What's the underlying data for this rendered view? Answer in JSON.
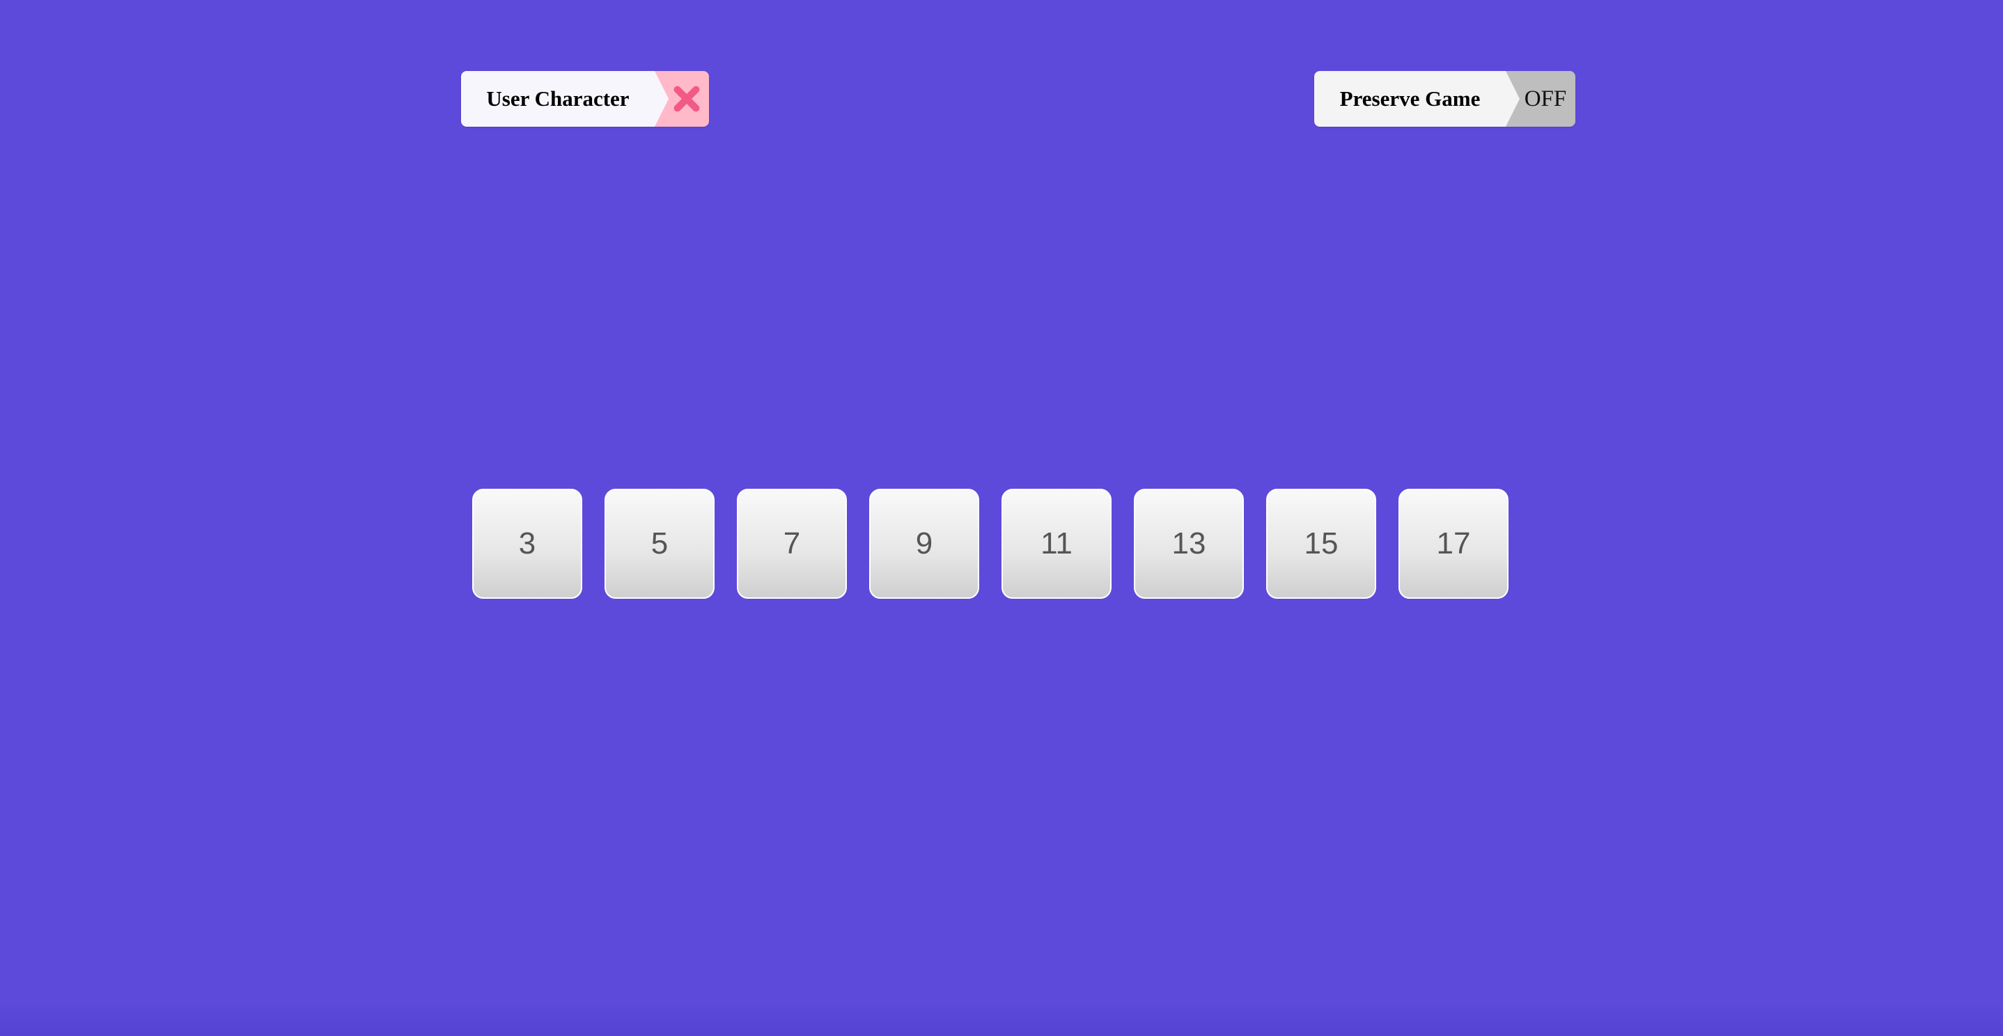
{
  "colors": {
    "background": "#5d4adb",
    "user_label_bg": "#f8f6fd",
    "user_state_bg": "#ffb9c8",
    "x_icon": "#f25a86",
    "preserve_state_bg": "#bebebe",
    "tile_text": "#555555"
  },
  "toggles": {
    "user_character": {
      "label": "User Character",
      "state_icon": "close-icon"
    },
    "preserve_game": {
      "label": "Preserve Game",
      "state": "OFF"
    }
  },
  "tiles": [
    "3",
    "5",
    "7",
    "9",
    "11",
    "13",
    "15",
    "17"
  ]
}
